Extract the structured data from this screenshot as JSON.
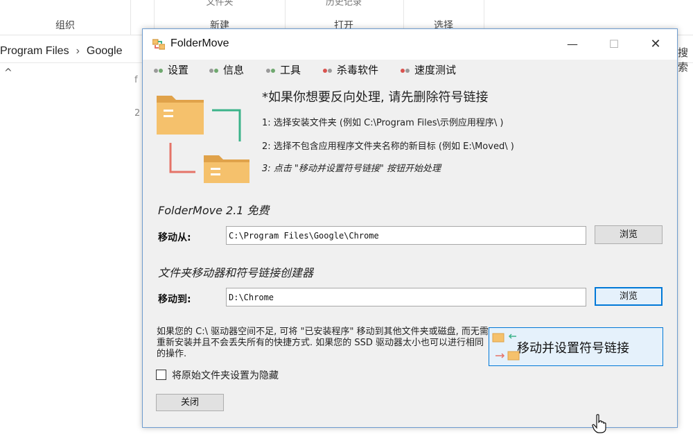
{
  "explorer": {
    "ribbon_groups": [
      {
        "top": "",
        "label": "组织"
      },
      {
        "top": "文件夹",
        "label": "新建"
      },
      {
        "top": "历史记录",
        "label": "打开"
      },
      {
        "top": "",
        "label": "选择"
      }
    ],
    "breadcrumb": [
      "Program Files",
      "Google"
    ],
    "search_label": "搜索",
    "nav_chevron": "^"
  },
  "window": {
    "title": "FolderMove",
    "controls": {
      "minimize": "—",
      "maximize": "☐",
      "close": "✕"
    }
  },
  "menu": [
    {
      "label": "设置",
      "dot_color": "#6fa86f"
    },
    {
      "label": "信息",
      "dot_color": "#6fa86f"
    },
    {
      "label": "工具",
      "dot_color": "#6fa86f"
    },
    {
      "label": "杀毒软件",
      "dot_color": "#d9534f"
    },
    {
      "label": "速度测试",
      "dot_color": "#d9534f"
    }
  ],
  "instructions": {
    "title": "*如果你想要反向处理, 请先删除符号链接",
    "step1": "1: 选择安装文件夹 (例如 C:\\Program Files\\示例应用程序\\ )",
    "step2": "2: 选择不包含应用程序文件夹名称的新目标 (例如 E:\\Moved\\ )",
    "step3": "3: 点击 \"移动并设置符号链接\" 按钮开始处理"
  },
  "form": {
    "heading1": "FolderMove 2.1 免费",
    "from_label": "移动从:",
    "from_value": "C:\\Program Files\\Google\\Chrome",
    "browse1": "浏览",
    "heading2": "文件夹移动器和符号链接创建器",
    "to_label": "移动到:",
    "to_value": "D:\\Chrome",
    "browse2": "浏览"
  },
  "info_text": "如果您的 C:\\ 驱动器空间不足, 可将 \"已安装程序\" 移动到其他文件夹或磁盘, 而无需重新安装并且不会丢失所有的快捷方式. 如果您的 SSD 驱动器太小也可以进行相同的操作.",
  "hide_checkbox": {
    "label": "将原始文件夹设置为隐藏",
    "checked": false
  },
  "move_button": "移动并设置符号链接",
  "close_button": "关闭",
  "colors": {
    "accent": "#0078d7",
    "folder": "#f5c16c",
    "folder_dark": "#e0a24a",
    "arrow_green": "#3bb38a",
    "arrow_red": "#e57368"
  }
}
